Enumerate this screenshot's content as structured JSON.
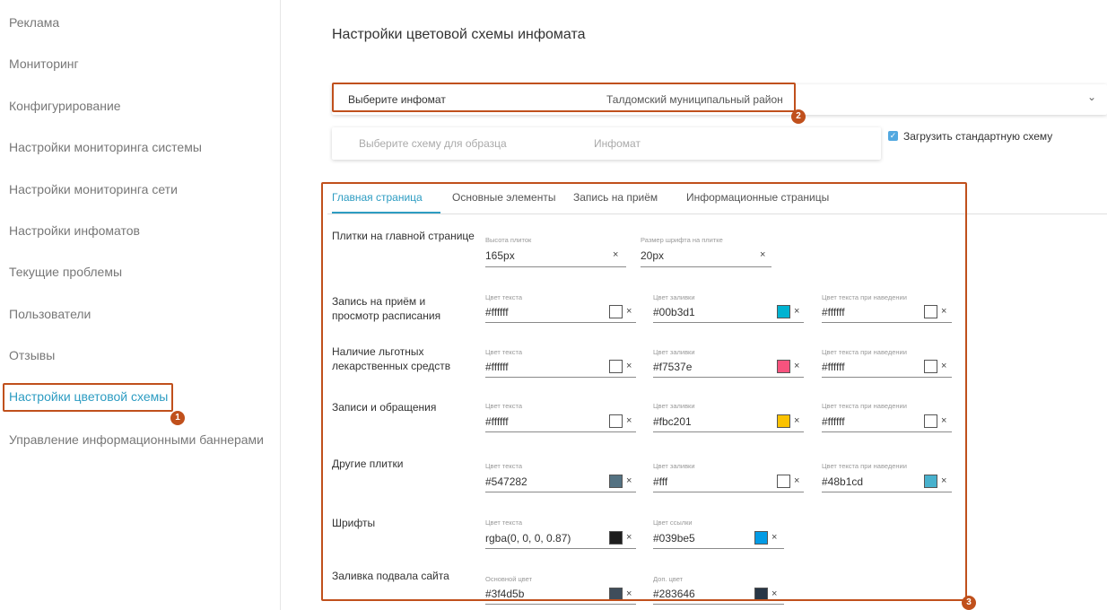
{
  "sidebar": {
    "items": [
      {
        "label": "Реклама"
      },
      {
        "label": "Мониторинг"
      },
      {
        "label": "Конфигурирование"
      },
      {
        "label": "Настройки мониторинга системы"
      },
      {
        "label": "Настройки мониторинга сети"
      },
      {
        "label": "Настройки инфоматов"
      },
      {
        "label": "Текущие проблемы"
      },
      {
        "label": "Пользователи"
      },
      {
        "label": "Отзывы"
      },
      {
        "label": "Настройки цветовой схемы"
      },
      {
        "label": "Управление информационными баннерами"
      }
    ],
    "active_index": 9
  },
  "page": {
    "title": "Настройки цветовой схемы инфомата"
  },
  "infomat_select": {
    "label": "Выберите инфомат",
    "value": "Талдомский муниципальный район"
  },
  "scheme_select": {
    "label": "Выберите схему для образца",
    "value": "Инфомат"
  },
  "load_default": {
    "label": "Загрузить стандартную схему",
    "checked": true
  },
  "tabs": [
    {
      "label": "Главная страница"
    },
    {
      "label": "Основные элементы"
    },
    {
      "label": "Запись на приём"
    },
    {
      "label": "Информационные страницы"
    }
  ],
  "rows": {
    "tiles": {
      "label": "Плитки на главной странице",
      "height": {
        "caption": "Высота плиток",
        "value": "165px"
      },
      "font_size": {
        "caption": "Размер шрифта на плитке",
        "value": "20px"
      }
    },
    "appointment": {
      "label_1": "Запись на приём и",
      "label_2": "просмотр расписания",
      "text": {
        "caption": "Цвет текста",
        "value": "#ffffff",
        "color": "#ffffff"
      },
      "fill": {
        "caption": "Цвет заливки",
        "value": "#00b3d1",
        "color": "#00b3d1"
      },
      "hover": {
        "caption": "Цвет текста при наведении",
        "value": "#ffffff",
        "color": "#ffffff"
      }
    },
    "benefit": {
      "label_1": "Наличие льготных",
      "label_2": "лекарственных средств",
      "text": {
        "caption": "Цвет текста",
        "value": "#ffffff",
        "color": "#ffffff"
      },
      "fill": {
        "caption": "Цвет заливки",
        "value": "#f7537e",
        "color": "#f7537e"
      },
      "hover": {
        "caption": "Цвет текста при наведении",
        "value": "#ffffff",
        "color": "#ffffff"
      }
    },
    "records": {
      "label": "Записи и обращения",
      "text": {
        "caption": "Цвет текста",
        "value": "#ffffff",
        "color": "#ffffff"
      },
      "fill": {
        "caption": "Цвет заливки",
        "value": "#fbc201",
        "color": "#fbc201"
      },
      "hover": {
        "caption": "Цвет текста при наведении",
        "value": "#ffffff",
        "color": "#ffffff"
      }
    },
    "other": {
      "label": "Другие плитки",
      "text": {
        "caption": "Цвет текста",
        "value": "#547282",
        "color": "#547282"
      },
      "fill": {
        "caption": "Цвет заливки",
        "value": "#fff",
        "color": "#ffffff"
      },
      "hover": {
        "caption": "Цвет текста при наведении",
        "value": "#48b1cd",
        "color": "#48b1cd"
      }
    },
    "fonts": {
      "label": "Шрифты",
      "text": {
        "caption": "Цвет текста",
        "value": "rgba(0, 0, 0, 0.87)",
        "color": "#1e1e1e"
      },
      "link": {
        "caption": "Цвет ссылки",
        "value": "#039be5",
        "color": "#039be5"
      }
    },
    "footer": {
      "label": "Заливка подвала сайта",
      "main": {
        "caption": "Основной цвет",
        "value": "#3f4d5b",
        "color": "#3f4d5b"
      },
      "extra": {
        "caption": "Доп. цвет",
        "value": "#283646",
        "color": "#283646"
      }
    }
  },
  "callouts": {
    "one": "1",
    "two": "2",
    "three": "3"
  },
  "icons": {
    "close": "×",
    "chevron": "⌄",
    "check": "✓"
  },
  "colors": {
    "accent": "#2d9cc2",
    "callout": "#c0501c"
  }
}
